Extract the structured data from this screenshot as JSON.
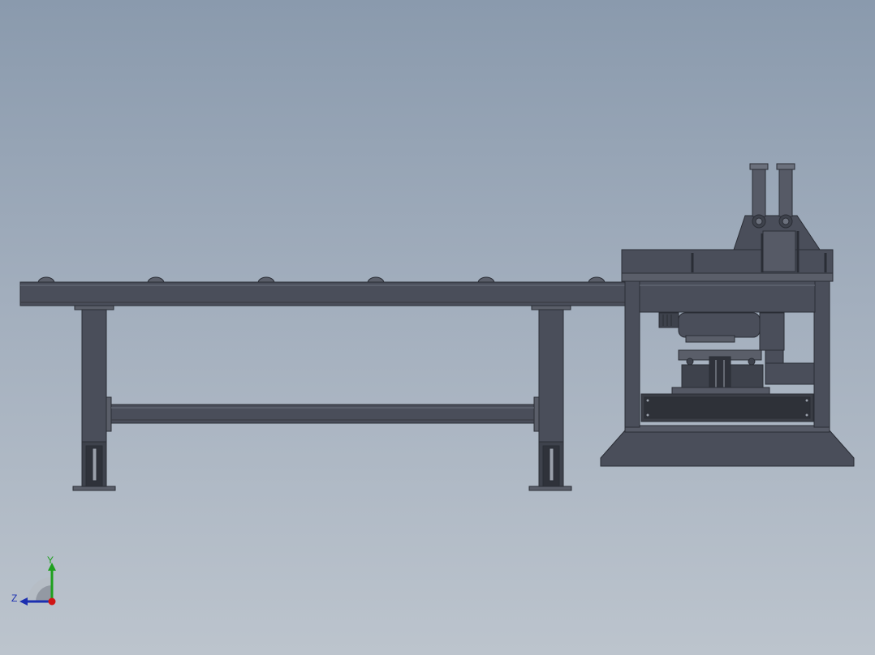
{
  "viewport": {
    "background_top": "#8a9aad",
    "background_bottom": "#bcc4cd",
    "model_color": "#4a4e5a",
    "model_dark": "#2a2d35",
    "model_light": "#6b707c"
  },
  "triad": {
    "y_label": "Y",
    "z_label": "Z",
    "y_color": "#1ea01e",
    "z_color": "#1c2fb0",
    "x_color": "#d01515"
  }
}
